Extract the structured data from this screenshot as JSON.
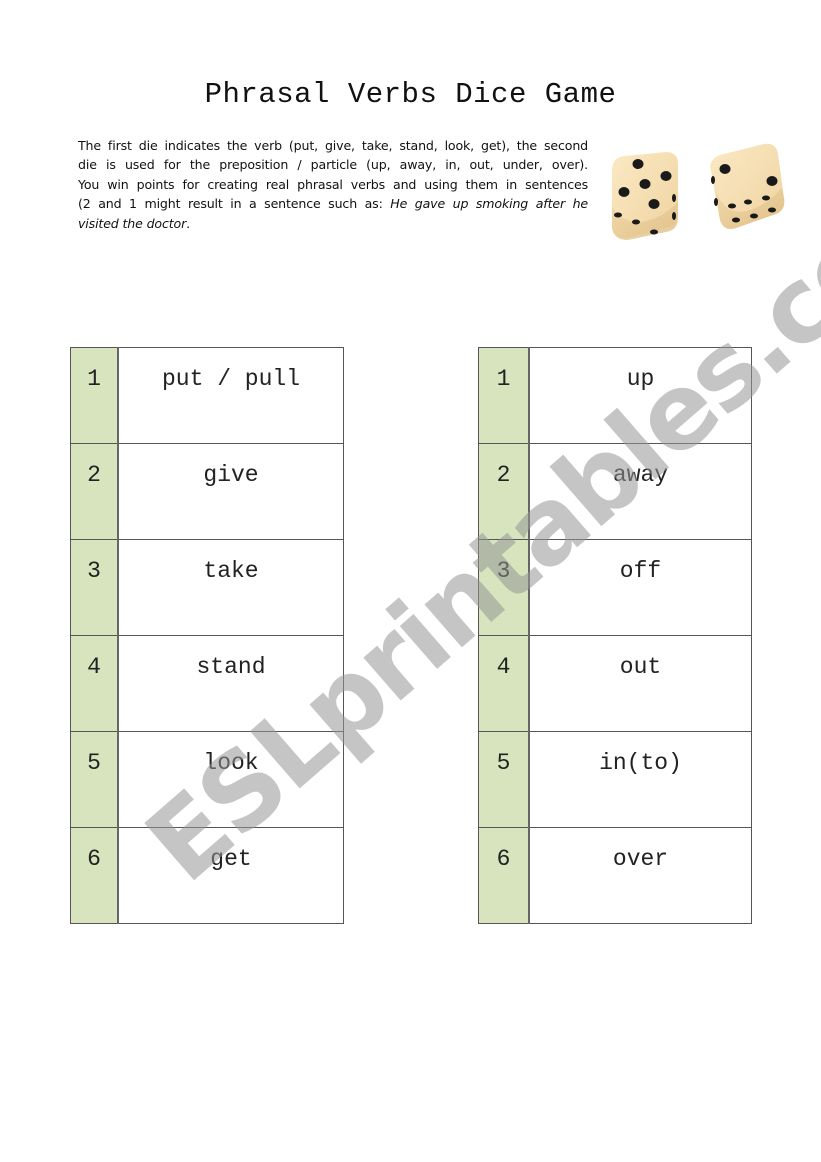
{
  "title": "Phrasal Verbs Dice Game",
  "intro": {
    "lines": [
      "The first die indicates the verb (put, give, take, stand, look, get), the second",
      "die is used for the preposition / particle (up, away, in, out, under, over).",
      "You win points for creating real phrasal verbs and using them in sentences",
      "(2 and 1 might result in a sentence such as:"
    ],
    "example_italic_part1": "He gave up smoking after he",
    "example_italic_part2": "visited the doctor",
    "end_punct": "."
  },
  "dice_image": {
    "icon": "dice-icon",
    "left_die_face": 5,
    "right_die_face": 2,
    "color": "#f3dcb0",
    "pip_color": "#1a1a1a"
  },
  "verbs_table": {
    "rows": [
      {
        "number": "1",
        "word": "put / pull"
      },
      {
        "number": "2",
        "word": "give"
      },
      {
        "number": "3",
        "word": "take"
      },
      {
        "number": "4",
        "word": "stand"
      },
      {
        "number": "5",
        "word": "look"
      },
      {
        "number": "6",
        "word": "get"
      }
    ]
  },
  "particles_table": {
    "rows": [
      {
        "number": "1",
        "word": "up"
      },
      {
        "number": "2",
        "word": "away"
      },
      {
        "number": "3",
        "word": "off"
      },
      {
        "number": "4",
        "word": "out"
      },
      {
        "number": "5",
        "word": "in(to)"
      },
      {
        "number": "6",
        "word": "over"
      }
    ]
  },
  "colors": {
    "number_column": "#d7e4bd",
    "border": "#555555",
    "watermark": "#969696"
  },
  "watermark": "ESLprintables.com"
}
